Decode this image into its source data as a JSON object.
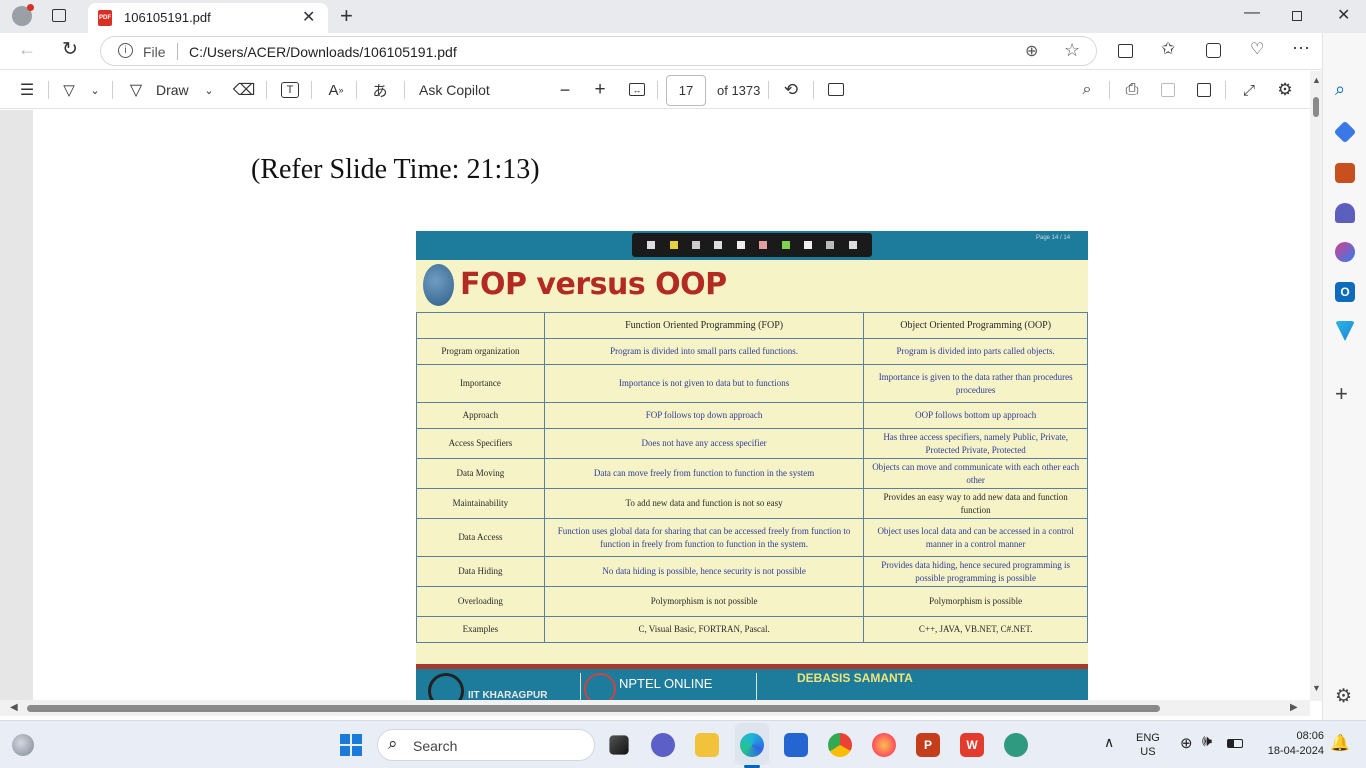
{
  "browser": {
    "tab_title": "106105191.pdf",
    "address_scheme": "File",
    "address_url": "C:/Users/ACER/Downloads/106105191.pdf"
  },
  "pdf_toolbar": {
    "draw_label": "Draw",
    "ask_copilot_label": "Ask Copilot",
    "page_number": "17",
    "page_total": "of 1373"
  },
  "document": {
    "caption": "(Refer Slide Time: 21:13)",
    "slide": {
      "page_indicator": "Page 14 / 14",
      "title": "FOP versus OOP",
      "columns": [
        "",
        "Function Oriented Programming (FOP)",
        "Object Oriented Programming (OOP)"
      ],
      "rows": [
        {
          "label": "Program organization",
          "fop": "Program is divided into small parts called functions.",
          "oop": "Program is divided into parts called objects."
        },
        {
          "label": "Importance",
          "fop": "Importance is not given to data but to functions",
          "oop": "Importance is given to the data rather than procedures procedures"
        },
        {
          "label": "Approach",
          "fop": "FOP follows top down approach",
          "oop": "OOP follows bottom up approach"
        },
        {
          "label": "Access Specifiers",
          "fop": "Does not have any access specifier",
          "oop": "Has three access specifiers, namely Public, Private, Protected Private, Protected"
        },
        {
          "label": "Data Moving",
          "fop": "Data can move freely from function to function in the system",
          "oop": "Objects can move and communicate with each other each other"
        },
        {
          "label": "Maintainability",
          "fop": "To add new data and function  is not so easy",
          "oop": "Provides an easy way to add new data and function function"
        },
        {
          "label": "Data Access",
          "fop": "Function uses global data for sharing that can be accessed freely from function to function in freely from function to function in the system.",
          "oop": "Object uses local data and can be accessed in a control manner in a control manner"
        },
        {
          "label": "Data Hiding",
          "fop": "No data hiding is possible, hence security is not possible",
          "oop": "Provides data hiding, hence secured programming is possible programming is possible"
        },
        {
          "label": "Overloading",
          "fop": "Polymorphism is not possible",
          "oop": "Polymorphism is possible"
        },
        {
          "label": "Examples",
          "fop": "C, Visual Basic, FORTRAN, Pascal.",
          "oop": "C++, JAVA, VB.NET, C#.NET."
        }
      ],
      "footer_left": "IIT KHARAGPUR",
      "footer_mid": "NPTEL ONLINE",
      "footer_right": "DEBASIS SAMANTA"
    }
  },
  "taskbar": {
    "search_placeholder": "Search",
    "language_top": "ENG",
    "language_bottom": "US",
    "time": "08:06",
    "date": "18-04-2024"
  },
  "colors": {
    "slide_background": "#f6f3c6",
    "slide_header_bar": "#1d7c9b",
    "slide_title": "#b32a22",
    "table_border": "#5b7fa0",
    "link_blue": "#2d3e9a",
    "accent_blue": "#0067c0"
  }
}
